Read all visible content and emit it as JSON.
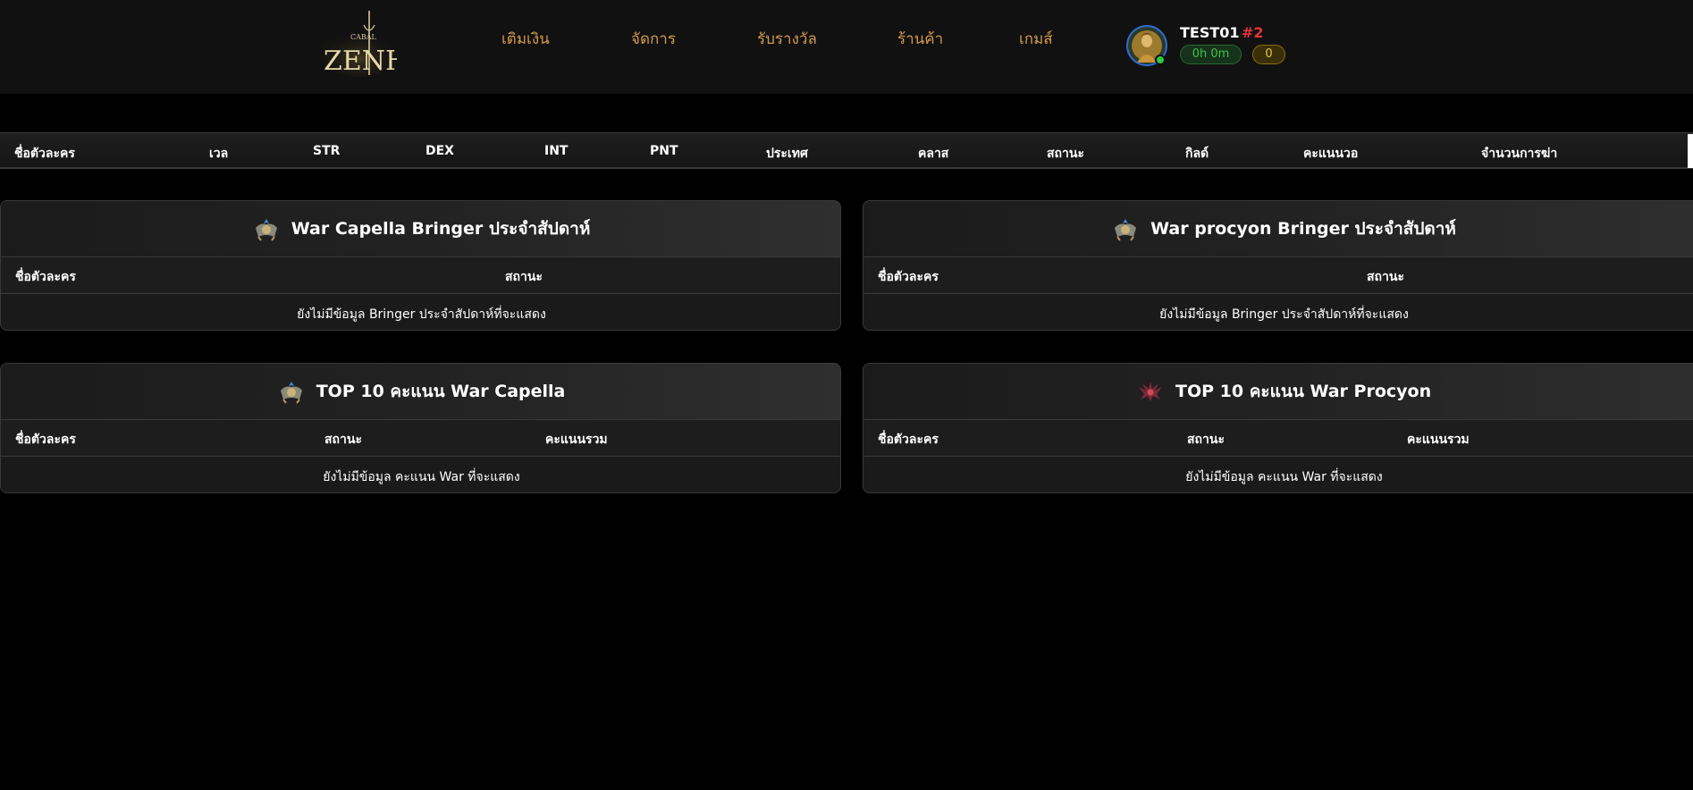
{
  "header": {
    "logo": {
      "small_text": "CABAL",
      "big_text": "ZENH"
    },
    "nav": [
      {
        "label": "เติมเงิน"
      },
      {
        "label": "จัดการ"
      },
      {
        "label": "รับรางวัล"
      },
      {
        "label": "ร้านค้า"
      },
      {
        "label": "เกมส์"
      }
    ],
    "user": {
      "name": "TEST01",
      "rank": "#2",
      "time": "0h 0m",
      "coins": "0",
      "status_color": "#2ecc40"
    }
  },
  "rank_table": {
    "columns": [
      "ชื่อตัวละคร",
      "เวล",
      "STR",
      "DEX",
      "INT",
      "PNT",
      "ประเทศ",
      "คลาส",
      "สถานะ",
      "กิลด์",
      "คะแนนวอ",
      "จำนวนการฆ่า"
    ]
  },
  "panels": {
    "capella_bringer": {
      "title": "War Capella Bringer ประจำสัปดาห์",
      "icon": "capella-emblem-icon",
      "columns": [
        "ชื่อตัวละคร",
        "สถานะ"
      ],
      "empty": "ยังไม่มีข้อมูล Bringer ประจำสัปดาห์ที่จะแสดง"
    },
    "procyon_bringer": {
      "title": "War procyon Bringer ประจำสัปดาห์",
      "icon": "capella-emblem-icon",
      "columns": [
        "ชื่อตัวละคร",
        "สถานะ"
      ],
      "empty": "ยังไม่มีข้อมูล Bringer ประจำสัปดาห์ที่จะแสดง"
    },
    "capella_top": {
      "title": "TOP 10 คะแนน War Capella",
      "icon": "capella-emblem-icon",
      "columns": [
        "ชื่อตัวละคร",
        "สถานะ",
        "คะแนนรวม"
      ],
      "empty": "ยังไม่มีข้อมูล คะแนน War ที่จะแสดง"
    },
    "procyon_top": {
      "title": "TOP 10 คะแนน War Procyon",
      "icon": "procyon-emblem-icon",
      "columns": [
        "ชื่อตัวละคร",
        "สถานะ",
        "คะแนนรวม"
      ],
      "empty": "ยังไม่มีข้อมูล คะแนน War ที่จะแสดง"
    }
  },
  "colors": {
    "nav_text": "#d39a4a",
    "rank_text": "#e3343c",
    "time_text": "#3fc24d",
    "coin_text": "#e5c53a"
  }
}
